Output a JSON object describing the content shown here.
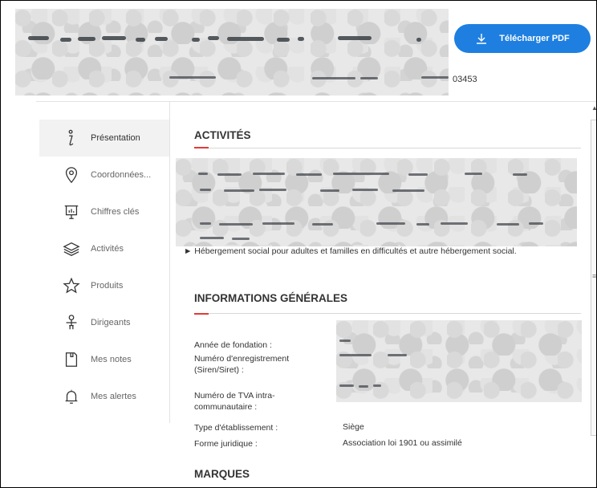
{
  "header": {
    "id_suffix": "03453",
    "download_label": "Télécharger PDF"
  },
  "sidebar": {
    "items": [
      {
        "label": "Présentation",
        "icon": "info-icon"
      },
      {
        "label": "Coordonnées...",
        "icon": "location-pin-icon"
      },
      {
        "label": "Chiffres clés",
        "icon": "key-figures-icon"
      },
      {
        "label": "Activités",
        "icon": "layers-icon"
      },
      {
        "label": "Produits",
        "icon": "star-icon"
      },
      {
        "label": "Dirigeants",
        "icon": "org-chart-icon"
      },
      {
        "label": "Mes notes",
        "icon": "notes-icon"
      },
      {
        "label": "Mes alertes",
        "icon": "bell-icon"
      }
    ]
  },
  "main": {
    "activities": {
      "title": "ACTIVITÉS",
      "text": "► Hébergement social pour adultes et familles en difficultés et autre hébergement social."
    },
    "general_info": {
      "title": "INFORMATIONS GÉNÉRALES",
      "rows": [
        {
          "label": "Année de fondation :",
          "value": ""
        },
        {
          "label": "Numéro d'enregistrement (Siren/Siret) :",
          "value": ""
        },
        {
          "label": "Numéro de TVA intra-communautaire :",
          "value": ""
        },
        {
          "label": "Type d'établissement :",
          "value": "Siège"
        },
        {
          "label": "Forme juridique :",
          "value": "Association loi 1901 ou assimilé"
        }
      ]
    },
    "brands": {
      "title": "MARQUES"
    }
  },
  "colors": {
    "accent": "#1e7fe0",
    "section_rule": "#e53935"
  }
}
